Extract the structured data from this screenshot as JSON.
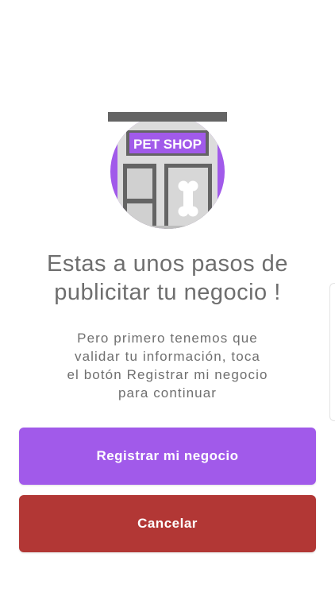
{
  "illustration": {
    "sign_text": "PET SHOP",
    "icon": "pet-shop-storefront-icon",
    "accent_color": "#a15aea"
  },
  "headline": {
    "line1": "Estas a unos pasos de",
    "line2": "publicitar tu negocio !"
  },
  "description": {
    "line1": "Pero primero tenemos que",
    "line2": "validar tu información, toca",
    "line3": "el botón Registrar mi negocio",
    "line4": "para continuar"
  },
  "buttons": {
    "register_label": "Registrar mi negocio",
    "register_color": "#a15aea",
    "cancel_label": "Cancelar",
    "cancel_color": "#b23735"
  }
}
